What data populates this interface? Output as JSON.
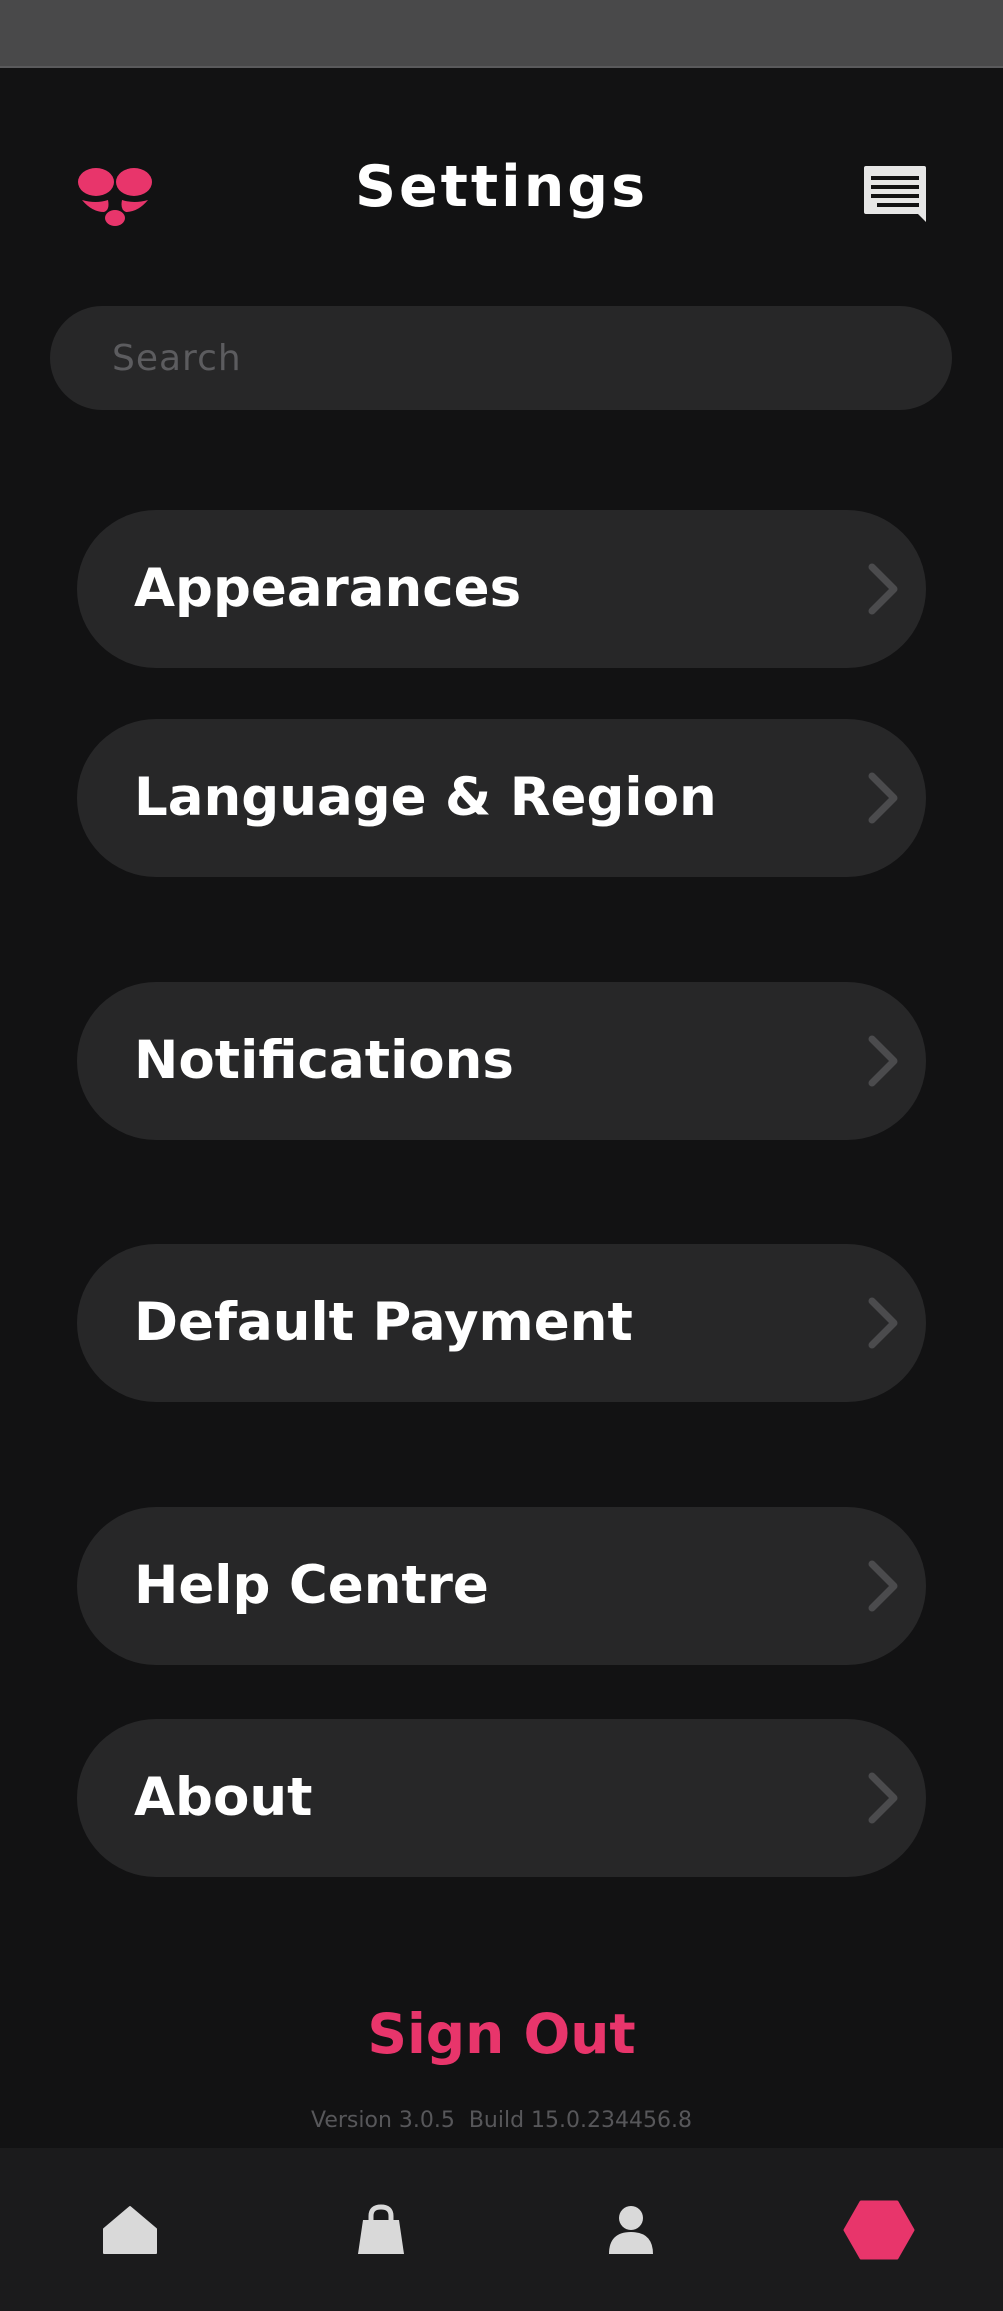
{
  "header": {
    "title": "Settings",
    "logo_icon": "logo-icon",
    "chat_icon": "chat-icon"
  },
  "search": {
    "placeholder": "Search",
    "value": ""
  },
  "menu": {
    "items": [
      {
        "label": "Appearances"
      },
      {
        "label": "Language & Region"
      },
      {
        "label": "Notifications"
      },
      {
        "label": "Default Payment"
      },
      {
        "label": "Help Centre"
      },
      {
        "label": "About"
      }
    ],
    "chevron_icon": "chevron-right-icon"
  },
  "sign_out": {
    "label": "Sign Out"
  },
  "version": {
    "text": "Version 3.0.5  Build 15.0.234456.8"
  },
  "tab_bar": {
    "tabs": [
      {
        "icon": "home-icon"
      },
      {
        "icon": "shopping-bag-icon"
      },
      {
        "icon": "profile-icon"
      },
      {
        "icon": "hexagon-icon",
        "active": true
      }
    ]
  },
  "colors": {
    "background": "#121213",
    "surface": "#272728",
    "accent": "#e8356b",
    "text": "#ffffff",
    "muted": "#57575a",
    "status_bar": "#49494a",
    "tab_bar": "#1b1b1c"
  }
}
